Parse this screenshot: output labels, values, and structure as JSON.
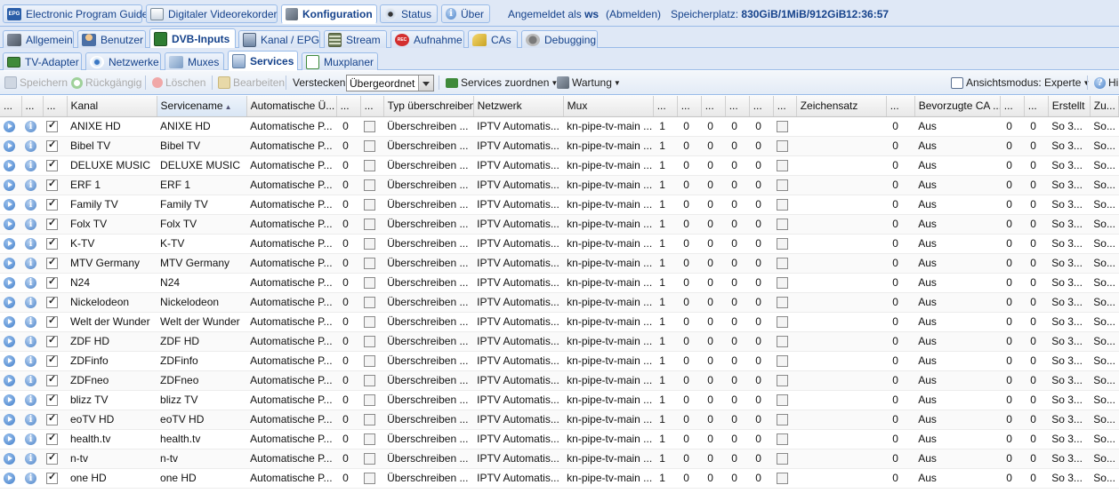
{
  "top_tabs": [
    "Electronic Program Guide",
    "Digitaler Videorekorder",
    "Konfiguration",
    "Status",
    "Über"
  ],
  "status": {
    "logged_in_prefix": "Angemeldet als",
    "user": "ws",
    "logout": "(Abmelden)",
    "storage_label": "Speicherplatz:",
    "storage_value": "830GiB/1MiB/912GiB",
    "time": "12:36:57"
  },
  "config_tabs": [
    "Allgemein",
    "Benutzer",
    "DVB-Inputs",
    "Kanal / EPG",
    "Stream",
    "Aufnahme",
    "CAs",
    "Debugging"
  ],
  "dvb_tabs": [
    "TV-Adapter",
    "Netzwerke",
    "Muxes",
    "Services",
    "Muxplaner"
  ],
  "toolbar": {
    "save": "Speichern",
    "undo": "Rückgängig",
    "delete": "Löschen",
    "edit": "Bearbeiten",
    "hide_label": "Verstecken:",
    "hide_value": "Übergeordnet d",
    "assign": "Services zuordnen",
    "maintenance": "Wartung",
    "view_mode": "Ansichtsmodus: Experte",
    "help": "Hi"
  },
  "columns": [
    "...",
    "...",
    "...",
    "Kanal",
    "Servicename",
    "Automatische Ü...",
    "...",
    "...",
    "Typ überschreiben",
    "Netzwerk",
    "Mux",
    "...",
    "...",
    "...",
    "...",
    "...",
    "...",
    "Zeichensatz",
    "...",
    "Bevorzugte CA ...",
    "...",
    "...",
    "Erstellt",
    "Zu..."
  ],
  "row_common": {
    "auto": "Automatische P...",
    "zero": "0",
    "type": "Überschreiben ...",
    "network": "IPTV Automatis...",
    "mux": "kn-pipe-tv-main ...",
    "one": "1",
    "ca": "Aus",
    "created": "So 3...",
    "last": "So..."
  },
  "rows": [
    {
      "kanal": "ANIXE HD",
      "service": "ANIXE HD"
    },
    {
      "kanal": "Bibel TV",
      "service": "Bibel TV"
    },
    {
      "kanal": "DELUXE MUSIC",
      "service": "DELUXE MUSIC"
    },
    {
      "kanal": "ERF 1",
      "service": "ERF 1"
    },
    {
      "kanal": "Family TV",
      "service": "Family TV"
    },
    {
      "kanal": "Folx TV",
      "service": "Folx TV"
    },
    {
      "kanal": "K-TV",
      "service": "K-TV"
    },
    {
      "kanal": "MTV Germany",
      "service": "MTV Germany"
    },
    {
      "kanal": "N24",
      "service": "N24"
    },
    {
      "kanal": "Nickelodeon",
      "service": "Nickelodeon"
    },
    {
      "kanal": "Welt der Wunder",
      "service": "Welt der Wunder"
    },
    {
      "kanal": "ZDF HD",
      "service": "ZDF HD"
    },
    {
      "kanal": "ZDFinfo",
      "service": "ZDFinfo"
    },
    {
      "kanal": "ZDFneo",
      "service": "ZDFneo"
    },
    {
      "kanal": "blizz TV",
      "service": "blizz TV"
    },
    {
      "kanal": "eoTV HD",
      "service": "eoTV HD"
    },
    {
      "kanal": "health.tv",
      "service": "health.tv"
    },
    {
      "kanal": "n-tv",
      "service": "n-tv"
    },
    {
      "kanal": "one HD",
      "service": "one HD"
    }
  ],
  "colors": {
    "tab_text": "#15428b",
    "tab_border": "#99bbe8",
    "header_bg": "#dfe8f6"
  }
}
